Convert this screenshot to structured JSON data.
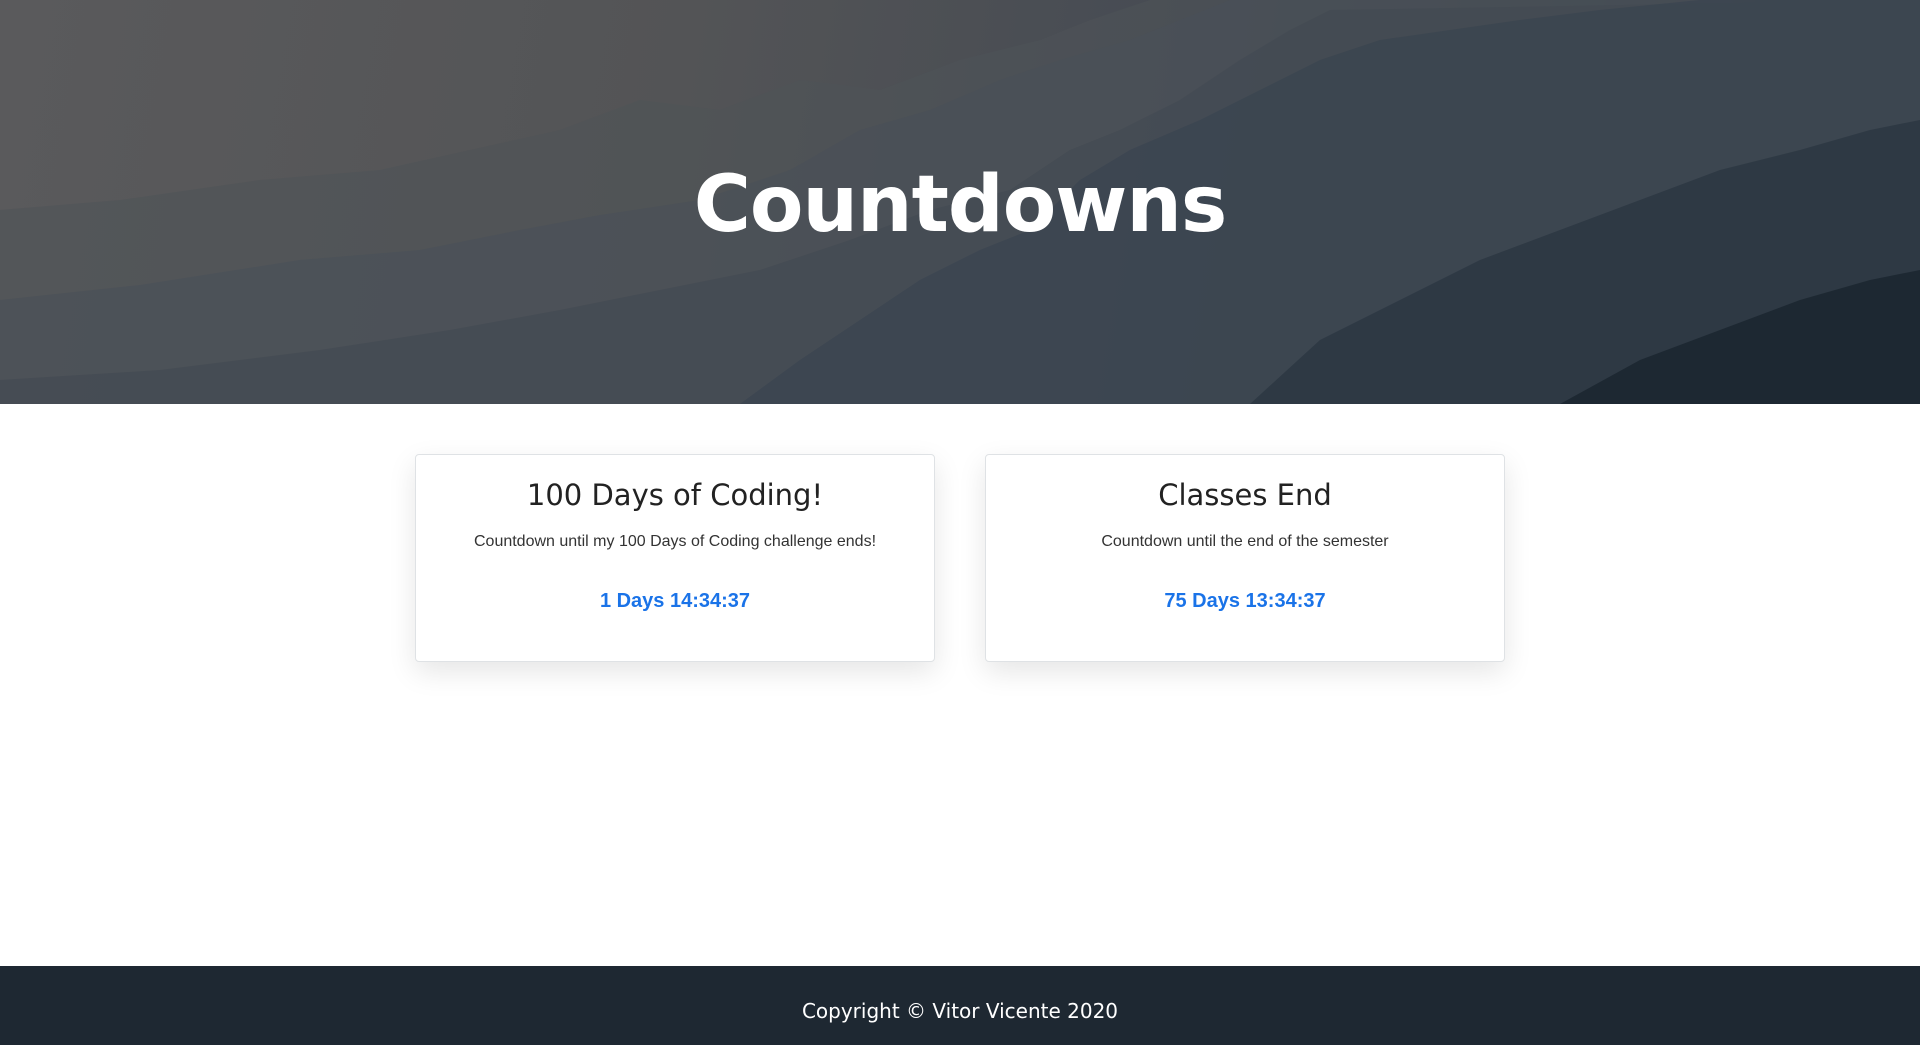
{
  "hero": {
    "title": "Countdowns"
  },
  "countdowns": [
    {
      "title": "100 Days of Coding!",
      "description": "Countdown until my 100 Days of Coding challenge ends!",
      "remaining": "1 Days 14:34:37"
    },
    {
      "title": "Classes End",
      "description": "Countdown until the end of the semester",
      "remaining": "75 Days 13:34:37"
    }
  ],
  "footer": {
    "copyright": "Copyright © Vitor Vicente 2020"
  },
  "colors": {
    "accent": "#1a73e8",
    "footer_bg": "#1e2832",
    "hero_dark": "#1f2b35"
  }
}
